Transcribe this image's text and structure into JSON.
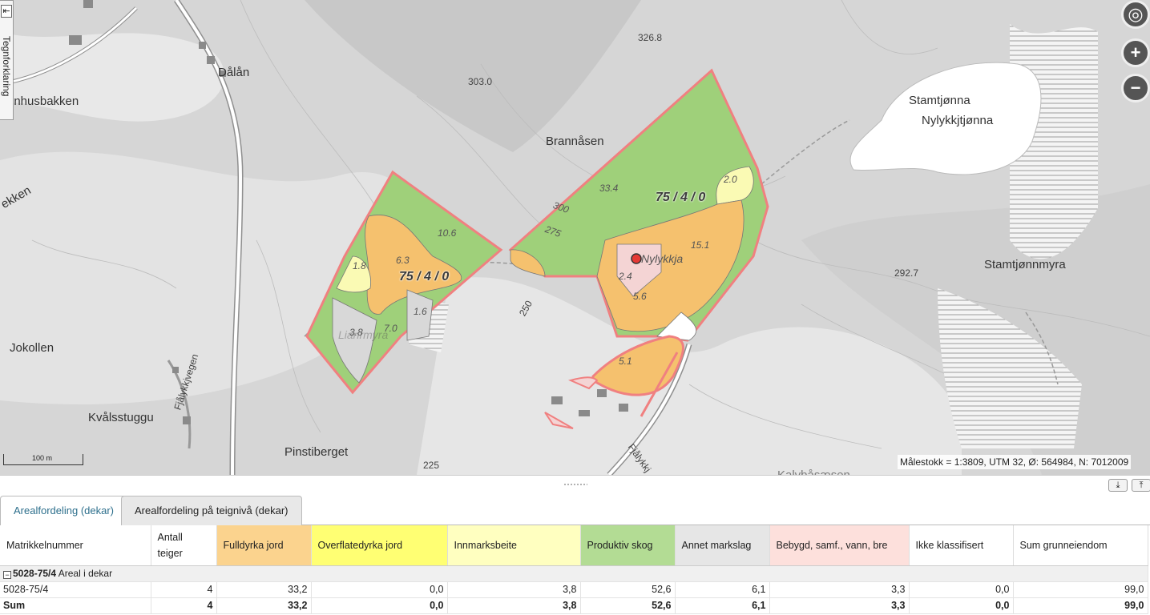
{
  "map": {
    "legend_toggle_label": "Tegnforklaring",
    "place_labels": [
      {
        "text": "Dålån",
        "cls": ""
      },
      {
        "text": "ernhusbakken",
        "cls": ""
      },
      {
        "text": "ekken",
        "cls": ""
      },
      {
        "text": "326.8",
        "cls": "small"
      },
      {
        "text": "303.0",
        "cls": "small"
      },
      {
        "text": "Brannåsen",
        "cls": ""
      },
      {
        "text": "Stamtjønna",
        "cls": ""
      },
      {
        "text": "Nylykkjtjønna",
        "cls": ""
      },
      {
        "text": "Stamtjønnmyra",
        "cls": ""
      },
      {
        "text": "292.7",
        "cls": "small"
      },
      {
        "text": "Jokollen",
        "cls": ""
      },
      {
        "text": "Kvålsstuggu",
        "cls": ""
      },
      {
        "text": "Pinstiberget",
        "cls": ""
      },
      {
        "text": "Fjålykkjvegen",
        "cls": ""
      },
      {
        "text": "Fjålykkj",
        "cls": ""
      },
      {
        "text": "225",
        "cls": "small"
      },
      {
        "text": "250",
        "cls": "small"
      },
      {
        "text": "300",
        "cls": "italic"
      },
      {
        "text": "275",
        "cls": "italic"
      },
      {
        "text": "Nylykkja",
        "cls": "italic"
      },
      {
        "text": "Lianrmyra",
        "cls": "italic"
      },
      {
        "text": "Kalvbåsæsen",
        "cls": ""
      }
    ],
    "area_labels": [
      "33.4",
      "2.0",
      "15.1",
      "2.4",
      "5.6",
      "5.1",
      "10.6",
      "6.3",
      "1.8",
      "1.6",
      "3.8",
      "7.0"
    ],
    "parcel_labels": [
      "75 / 4 / 0",
      "75 / 4 / 0"
    ],
    "zoom_controls": {
      "locate": "◎",
      "zoom_in": "+",
      "zoom_out": "−"
    },
    "scale_bar_label": "100 m",
    "scale_info": "Målestokk = 1:3809, UTM 32, Ø: 564984, N: 7012009",
    "colors": {
      "productive_forest": "#9fd07a",
      "fully_cultivated": "#f5c16e",
      "pasture": "#fafab4",
      "built": "#f4d4d4",
      "other": "#d6d6d6",
      "boundary": "#f08080"
    }
  },
  "panel": {
    "dock_down_icon": "⤓",
    "dock_up_icon": "⤒"
  },
  "tabs": [
    {
      "label": "Arealfordeling (dekar)",
      "active": true
    },
    {
      "label": "Arealfordeling på teignivå (dekar)",
      "active": false
    }
  ],
  "table": {
    "columns": [
      {
        "label": "Matrikkelnummer",
        "color": "#ffffff"
      },
      {
        "label": "Antall teiger",
        "color": "#ffffff"
      },
      {
        "label": "Fulldyrka jord",
        "color": "#fbd38e"
      },
      {
        "label": "Overflatedyrka jord",
        "color": "#ffff73"
      },
      {
        "label": "Innmarksbeite",
        "color": "#ffffc0"
      },
      {
        "label": "Produktiv skog",
        "color": "#b3dc94"
      },
      {
        "label": "Annet markslag",
        "color": "#e6e6e6"
      },
      {
        "label": "Bebygd, samf., vann, bre",
        "color": "#fde0dc"
      },
      {
        "label": "Ikke klassifisert",
        "color": "#ffffff"
      },
      {
        "label": "Sum grunneiendom",
        "color": "#ffffff"
      }
    ],
    "group": {
      "expander": "−",
      "name": "5028-75/4",
      "suffix": "Areal i dekar"
    },
    "rows": [
      [
        "5028-75/4",
        "4",
        "33,2",
        "0,0",
        "3,8",
        "52,6",
        "6,1",
        "3,3",
        "0,0",
        "99,0"
      ]
    ],
    "sum_row": [
      "Sum",
      "4",
      "33,2",
      "0,0",
      "3,8",
      "52,6",
      "6,1",
      "3,3",
      "0,0",
      "99,0"
    ]
  }
}
